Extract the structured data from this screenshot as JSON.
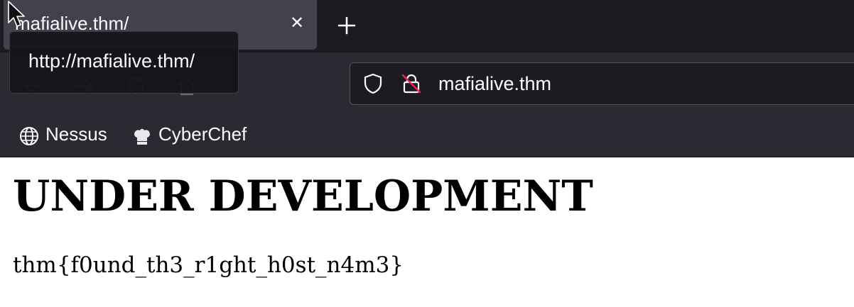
{
  "browser": {
    "tab": {
      "title": "mafialive.thm/",
      "close_icon": "close-icon"
    },
    "new_tab_icon": "plus-icon",
    "tooltip": "http://mafialive.thm/",
    "nav": {
      "back_icon": "arrow-left-icon",
      "forward_icon": "arrow-right-icon",
      "reload_icon": "reload-icon",
      "home_icon": "home-icon"
    },
    "urlbar": {
      "url": "mafialive.thm",
      "shield_icon": "shield-icon",
      "insecure_lock_icon": "insecure-lock-icon"
    },
    "bookmarks": [
      {
        "label": "Nessus",
        "icon": "globe-icon"
      },
      {
        "label": "CyberChef",
        "icon": "chef-hat-icon"
      }
    ]
  },
  "page": {
    "heading": "UNDER DEVELOPMENT",
    "flag": "thm{f0und_th3_r1ght_h0st_n4m3}"
  },
  "colors": {
    "tabstrip_bg": "#1c1b22",
    "toolbar_bg": "#2b2a33",
    "active_tab_bg": "#42414d",
    "urlbar_bg": "#1c1b22",
    "text_light": "#fbfbfe",
    "insecure_red": "#e22850"
  }
}
